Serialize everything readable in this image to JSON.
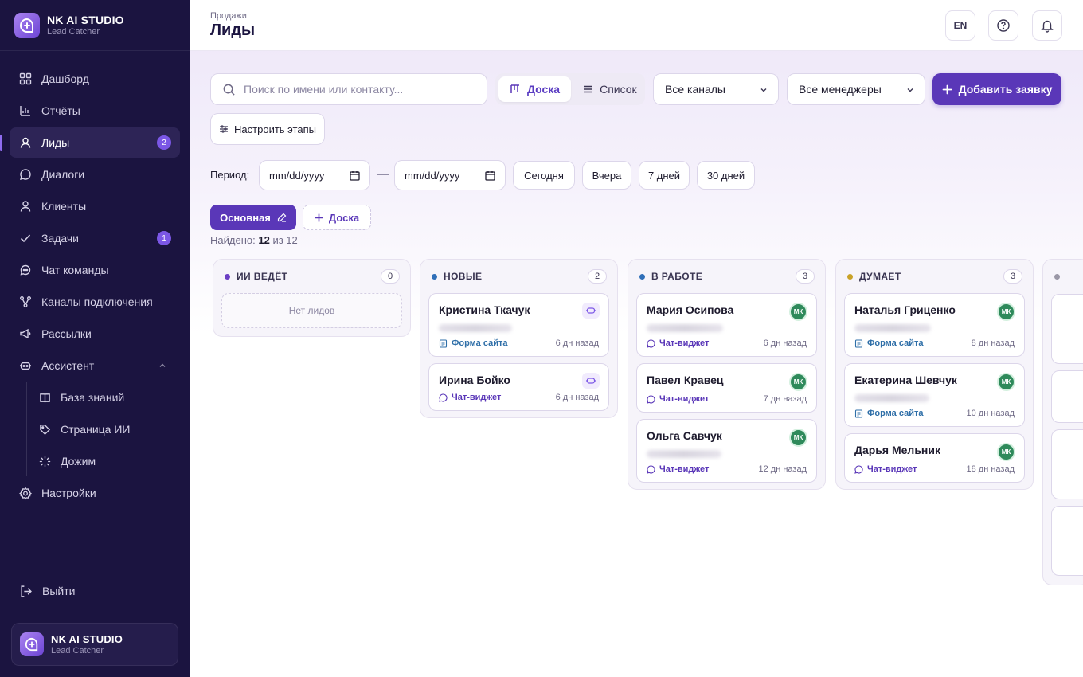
{
  "brand": {
    "title": "NK AI STUDIO",
    "subtitle": "Lead Catcher"
  },
  "sidebar": {
    "items": [
      {
        "label": "Дашборд",
        "icon": "dashboard-icon"
      },
      {
        "label": "Отчёты",
        "icon": "reports-icon"
      },
      {
        "label": "Лиды",
        "icon": "user-icon",
        "badge": "2",
        "active": true
      },
      {
        "label": "Диалоги",
        "icon": "chat-icon"
      },
      {
        "label": "Клиенты",
        "icon": "clients-icon"
      },
      {
        "label": "Задачи",
        "icon": "check-icon",
        "badge": "1"
      },
      {
        "label": "Чат команды",
        "icon": "team-chat-icon"
      },
      {
        "label": "Каналы подключения",
        "icon": "channels-icon"
      },
      {
        "label": "Рассылки",
        "icon": "megaphone-icon"
      },
      {
        "label": "Ассистент",
        "icon": "robot-icon"
      }
    ],
    "sub_items": [
      {
        "label": "База знаний",
        "icon": "book-icon"
      },
      {
        "label": "Страница ИИ",
        "icon": "tag-icon"
      },
      {
        "label": "Дожим",
        "icon": "spinner-icon"
      }
    ],
    "settings": "Настройки",
    "logout": "Выйти"
  },
  "header": {
    "breadcrumb": "Продажи",
    "title": "Лиды",
    "lang": "EN"
  },
  "toolbar": {
    "search_placeholder": "Поиск по имени или контакту...",
    "view_board": "Доска",
    "view_list": "Список",
    "channels_select": "Все каналы",
    "managers_select": "Все менеджеры",
    "add_button": "Добавить заявку",
    "stages_button": "Настроить этапы"
  },
  "period": {
    "label": "Период:",
    "from": "mm/dd/yyyy",
    "to": "mm/dd/yyyy",
    "separator": "—",
    "chips": [
      "Сегодня",
      "Вчера",
      "7 дней",
      "30 дней"
    ]
  },
  "boards": {
    "active": "Основная",
    "add": "Доска"
  },
  "found": {
    "prefix": "Найдено:",
    "count": "12",
    "mid": "из",
    "total": "12"
  },
  "columns": [
    {
      "title": "ИИ ВЕДЁТ",
      "count": "0",
      "color": "#6b3fc4",
      "empty": "Нет лидов",
      "cards": []
    },
    {
      "title": "НОВЫЕ",
      "count": "2",
      "color": "#2f6fb8",
      "cards": [
        {
          "name": "Кристина Ткачук",
          "source": "Форма сайта",
          "age": "6 дн назад",
          "owner": "bot"
        },
        {
          "name": "Ирина Бойко",
          "source": "Чат-виджет",
          "age": "6 дн назад",
          "owner": "bot"
        }
      ]
    },
    {
      "title": "В РАБОТЕ",
      "count": "3",
      "color": "#2f6fb8",
      "cards": [
        {
          "name": "Мария Осипова",
          "source": "Чат-виджет",
          "age": "6 дн назад",
          "owner": "МК"
        },
        {
          "name": "Павел Кравец",
          "source": "Чат-виджет",
          "age": "7 дн назад",
          "owner": "МК"
        },
        {
          "name": "Ольга Савчук",
          "source": "Чат-виджет",
          "age": "12 дн назад",
          "owner": "МК"
        }
      ]
    },
    {
      "title": "ДУМАЕТ",
      "count": "3",
      "color": "#c9a227",
      "cards": [
        {
          "name": "Наталья Гриценко",
          "source": "Форма сайта",
          "age": "8 дн назад",
          "owner": "МК"
        },
        {
          "name": "Екатерина Шевчук",
          "source": "Форма сайта",
          "age": "10 дн назад",
          "owner": "МК"
        },
        {
          "name": "Дарья Мельник",
          "source": "Чат-виджет",
          "age": "18 дн назад",
          "owner": "МК"
        }
      ]
    }
  ],
  "colors": {
    "accent": "#5a37b8",
    "sidebar_bg": "#1b1440",
    "owner_badge": "#2f8a5b"
  }
}
